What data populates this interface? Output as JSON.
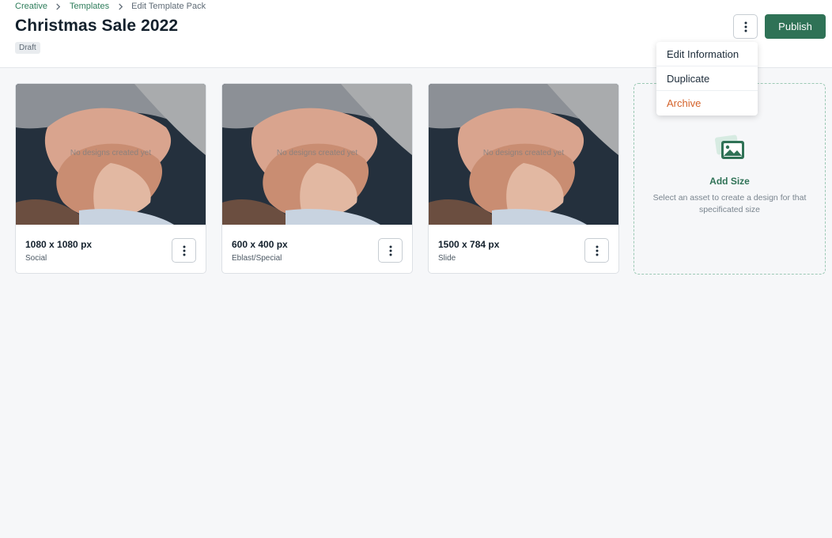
{
  "breadcrumb": {
    "items": [
      "Creative",
      "Templates",
      "Edit Template Pack"
    ]
  },
  "page": {
    "title": "Christmas Sale 2022",
    "status": "Draft"
  },
  "header": {
    "more_icon": "more-vertical-icon",
    "publish_label": "Publish",
    "accent_color": "#2f7256"
  },
  "dropdown": {
    "items": [
      {
        "label": "Edit Information"
      },
      {
        "label": "Duplicate"
      },
      {
        "label": "Archive",
        "color": "#d4622a"
      }
    ]
  },
  "cards": [
    {
      "size": "1080 x 1080 px",
      "type": "Social",
      "placeholder": "No designs created yet"
    },
    {
      "size": "600 x 400 px",
      "type": "Eblast/Special",
      "placeholder": "No designs created yet"
    },
    {
      "size": "1500 x 784 px",
      "type": "Slide",
      "placeholder": "No designs created yet"
    }
  ],
  "add_size": {
    "icon": "image-icon",
    "title": "Add Size",
    "description": "Select an asset to create a design for that specificated size"
  }
}
